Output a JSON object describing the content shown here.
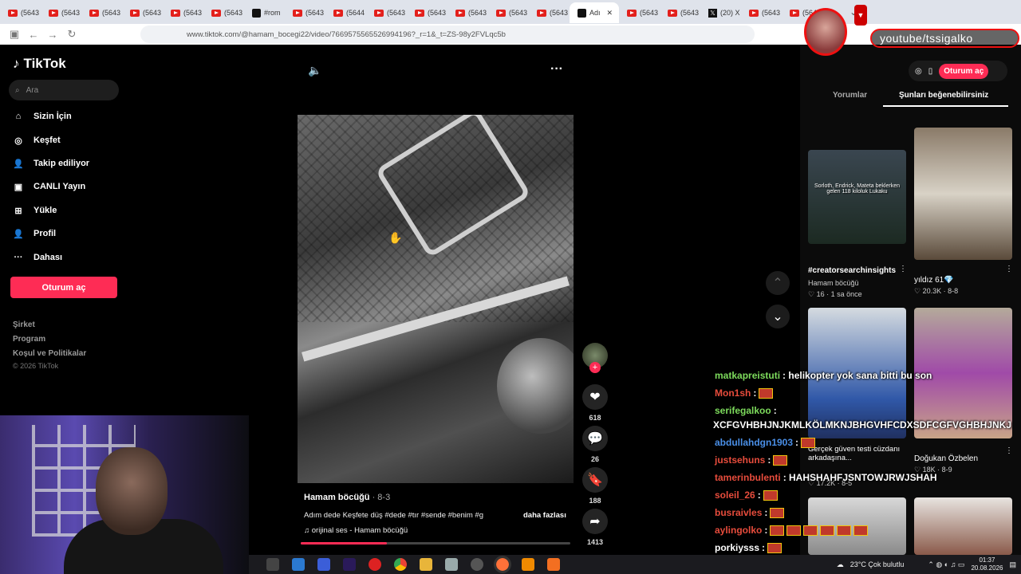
{
  "browser": {
    "tabs": [
      {
        "label": "(5643"
      },
      {
        "label": "(5643"
      },
      {
        "label": "(5643"
      },
      {
        "label": "(5643"
      },
      {
        "label": "(5643"
      },
      {
        "label": "(5643"
      },
      {
        "label": "#rom"
      },
      {
        "label": "(5643"
      },
      {
        "label": "(5644"
      },
      {
        "label": "(5643"
      },
      {
        "label": "(5643"
      },
      {
        "label": "(5643"
      },
      {
        "label": "(5643"
      },
      {
        "label": "(5643"
      },
      {
        "label": "Adı"
      },
      {
        "label": "(5643"
      },
      {
        "label": "(5643"
      },
      {
        "label": "(20) X"
      },
      {
        "label": "(5643"
      },
      {
        "label": "(5643"
      }
    ],
    "url": "www.tiktok.com/@hamam_bocegi22/video/7669575565526994196?_r=1&_t=ZS-98y2FVLqc5b"
  },
  "sidebar": {
    "logo": "TikTok",
    "search_placeholder": "Ara",
    "items": [
      {
        "label": "Sizin İçin",
        "icon": "home-icon"
      },
      {
        "label": "Keşfet",
        "icon": "compass-icon"
      },
      {
        "label": "Takip ediliyor",
        "icon": "following-icon"
      },
      {
        "label": "CANLI Yayın",
        "icon": "live-icon"
      },
      {
        "label": "Yükle",
        "icon": "upload-icon"
      },
      {
        "label": "Profil",
        "icon": "profile-icon"
      },
      {
        "label": "Dahası",
        "icon": "more-icon"
      }
    ],
    "login": "Oturum aç",
    "footer": [
      "Şirket",
      "Program",
      "Koşul ve Politikalar",
      "© 2026 TikTok"
    ]
  },
  "video": {
    "author": "Hamam böcüğü",
    "date": "· 8-3",
    "description": "Adım dede Keşfete düş #dede #tır #sende #benim #g",
    "more": "daha fazlası",
    "sound": "♫  orijinal ses - Hamam böcüğü",
    "progress": 0.32,
    "likes": "618",
    "comments": "26",
    "saves": "188",
    "shares": "1413"
  },
  "right": {
    "login": "Oturum aç",
    "tab_comments": "Yorumlar",
    "tab_suggest": "Şunları beğenebilirsiniz",
    "cards": [
      {
        "title": "#creatorsearchinsights",
        "sub": "Hamam böcüğü",
        "stats": "♡ 16  ·  1 sa önce",
        "overlay": "Sorloth, Endrick, Mateta beklerken gelen 118 kiloluk Lukaku"
      },
      {
        "title": "yıldız 61💎",
        "sub": "",
        "stats": "♡ 20.3K  ·  8-8",
        "overlay": ""
      },
      {
        "title": "Gerçek güven testi cüzdanı arkadaşına...",
        "sub": "",
        "stats": "♡ 17.2K  ·  8-5",
        "overlay": ""
      },
      {
        "title": "Doğukan Özbelen",
        "sub": "",
        "stats": "♡ 18K  ·  8-9",
        "overlay": ""
      }
    ]
  },
  "chat": [
    {
      "user": "matkapreistuti",
      "color": "#7ddb5c",
      "msg": ": helikopter yok sana bitti bu son",
      "emotes": 0
    },
    {
      "user": "Mon1sh",
      "color": "#e74c3c",
      "msg": ":",
      "emotes": 1
    },
    {
      "user": "serifegalkoo",
      "color": "#7ddb5c",
      "msg": ":",
      "emotes": 0
    },
    {
      "user": "",
      "color": "#fff",
      "msg": "XCFGVHBHJNJKMLKÖLMKNJBHGVHFCDXSDFCGFVGHBHJNKJ",
      "emotes": 0
    },
    {
      "user": "abdullahdgn1903",
      "color": "#4a8fe7",
      "msg": ":",
      "emotes": 1
    },
    {
      "user": "justsehuns",
      "color": "#e74c3c",
      "msg": ":",
      "emotes": 1
    },
    {
      "user": "tamerinbulenti",
      "color": "#e74c3c",
      "msg": ": HAHSHAHFJSNTOWJRWJSHAH",
      "emotes": 0
    },
    {
      "user": "soleil_26",
      "color": "#e74c3c",
      "msg": ":",
      "emotes": 1
    },
    {
      "user": "busraivles",
      "color": "#e74c3c",
      "msg": ":",
      "emotes": 1
    },
    {
      "user": "aylingolko",
      "color": "#e74c3c",
      "msg": ":",
      "emotes": 6
    },
    {
      "user": "porkiysss",
      "color": "#fff",
      "msg": ":",
      "emotes": 1
    }
  ],
  "streamer": {
    "channel": "youtube/tssigalko"
  },
  "taskbar": {
    "weather": "23°C  Çok bulutlu",
    "time": "01:37",
    "date": "20.08.2026"
  },
  "colors": {
    "accent": "#fe2c55"
  }
}
